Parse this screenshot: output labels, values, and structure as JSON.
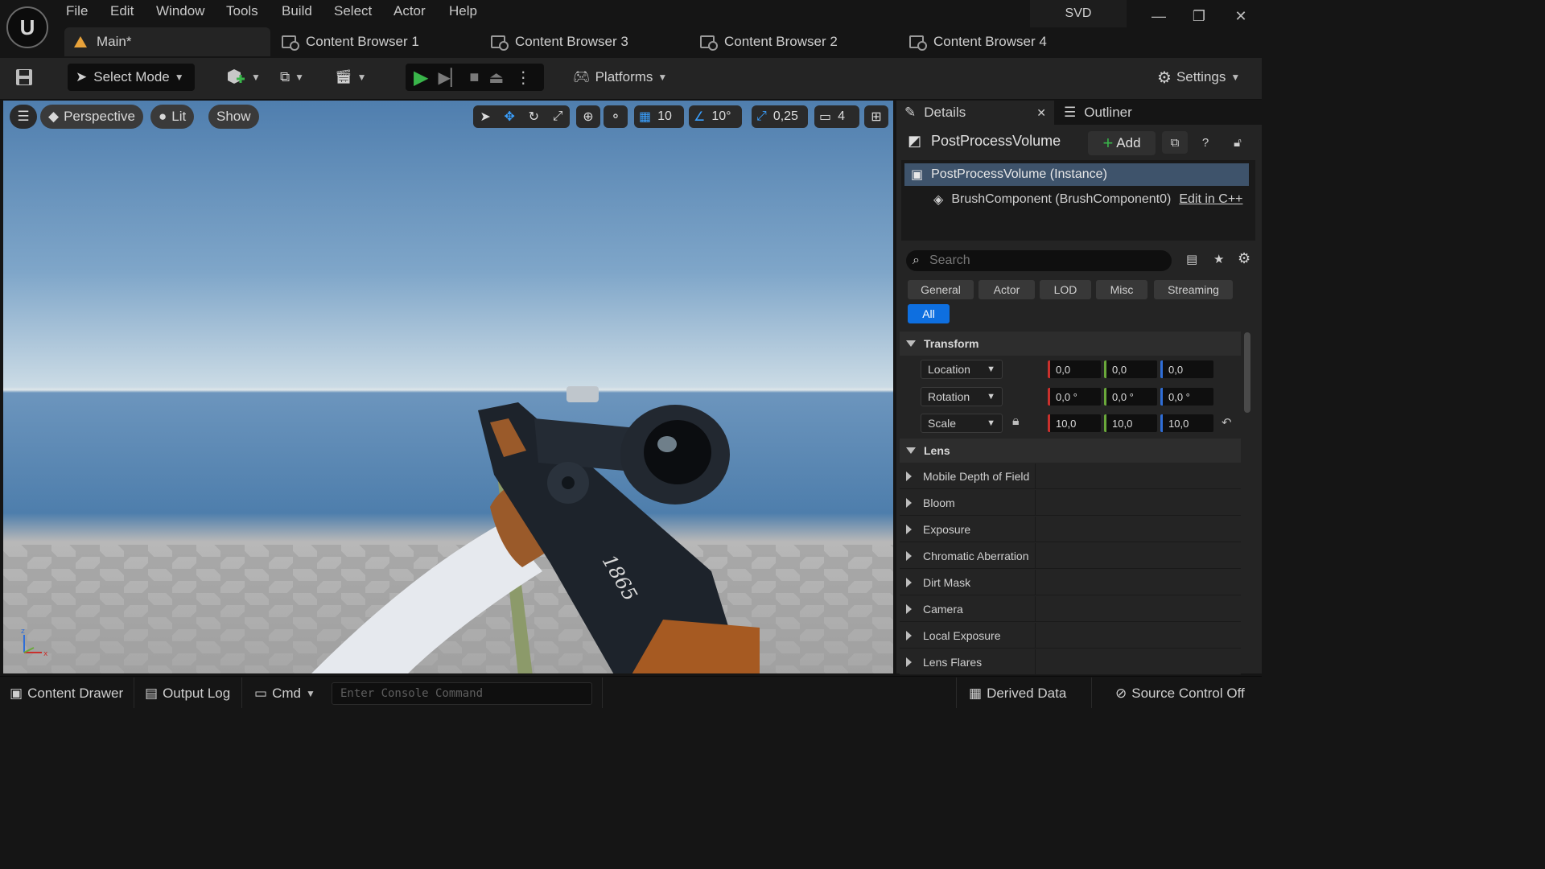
{
  "menu": [
    "File",
    "Edit",
    "Window",
    "Tools",
    "Build",
    "Select",
    "Actor",
    "Help"
  ],
  "project_name": "SVD",
  "tabs": {
    "main": "Main*",
    "browsers": [
      "Content Browser 1",
      "Content Browser 3",
      "Content Browser 2",
      "Content Browser 4"
    ]
  },
  "toolbar": {
    "select_mode": "Select Mode",
    "platforms": "Platforms",
    "settings": "Settings"
  },
  "viewport": {
    "perspective": "Perspective",
    "lit": "Lit",
    "show": "Show",
    "grid_snap": "10",
    "rotation_snap": "10°",
    "scale_snap": "0,25",
    "camera_speed": "4",
    "rifle_marking": "1865"
  },
  "details": {
    "tab_details": "Details",
    "tab_outliner": "Outliner",
    "actor_name": "PostProcessVolume",
    "add_label": "Add",
    "component_root": "PostProcessVolume (Instance)",
    "component_child": "BrushComponent (BrushComponent0)",
    "edit_cpp": "Edit in C++",
    "search_placeholder": "Search",
    "filters": [
      "General",
      "Actor",
      "LOD",
      "Misc",
      "Streaming"
    ],
    "filter_all": "All",
    "transform_section": "Transform",
    "transform": [
      {
        "label": "Location",
        "x": "0,0",
        "y": "0,0",
        "z": "0,0"
      },
      {
        "label": "Rotation",
        "x": "0,0 °",
        "y": "0,0 °",
        "z": "0,0 °"
      },
      {
        "label": "Scale",
        "x": "10,0",
        "y": "10,0",
        "z": "10,0"
      }
    ],
    "lens_section": "Lens",
    "lens_items": [
      "Mobile Depth of Field",
      "Bloom",
      "Exposure",
      "Chromatic Aberration",
      "Dirt Mask",
      "Camera",
      "Local Exposure",
      "Lens Flares"
    ]
  },
  "statusbar": {
    "content_drawer": "Content Drawer",
    "output_log": "Output Log",
    "cmd": "Cmd",
    "console_placeholder": "Enter Console Command",
    "derived_data": "Derived Data",
    "source_control": "Source Control Off"
  },
  "colors": {
    "accent_blue": "#0e6fe0",
    "play_green": "#39b54a",
    "selected_row": "#3e536b",
    "axis_x": "#c9302c",
    "axis_y": "#6aa83a",
    "axis_z": "#2f6ed8"
  }
}
